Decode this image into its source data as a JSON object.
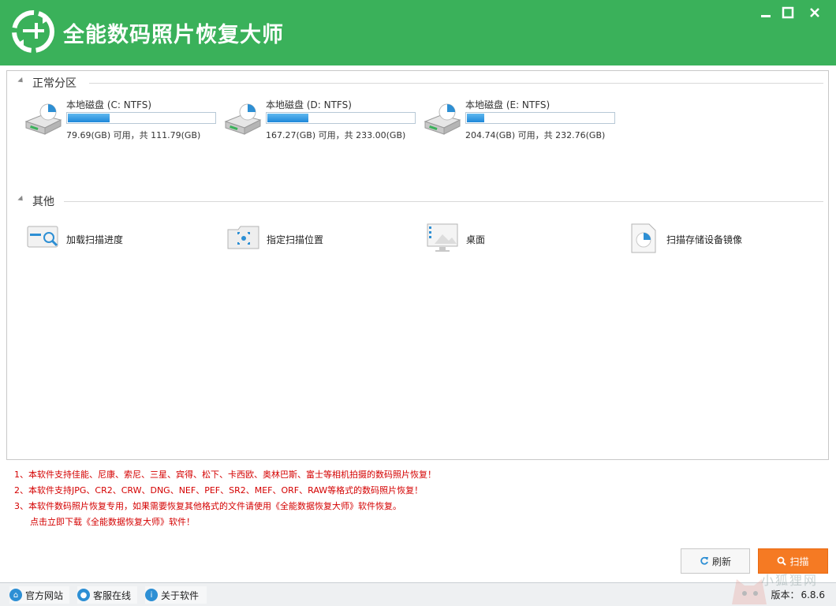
{
  "app": {
    "title": "全能数码照片恢复大师",
    "accent_color": "#3ab15a",
    "window_controls": {
      "minimize_icon": "minimize-icon",
      "maximize_icon": "maximize-icon",
      "close_icon": "close-icon"
    }
  },
  "sections": {
    "partitions_title": "正常分区",
    "other_title": "其他"
  },
  "disks": [
    {
      "name": "本地磁盘 (C: NTFS)",
      "info": "79.69(GB) 可用，共 111.79(GB)",
      "used_fraction": 0.287
    },
    {
      "name": "本地磁盘 (D: NTFS)",
      "info": "167.27(GB) 可用，共 233.00(GB)",
      "used_fraction": 0.282
    },
    {
      "name": "本地磁盘 (E: NTFS)",
      "info": "204.74(GB) 可用，共 232.76(GB)",
      "used_fraction": 0.12
    }
  ],
  "others": [
    {
      "label": "加载扫描进度",
      "icon": "load-progress-icon"
    },
    {
      "label": "指定扫描位置",
      "icon": "scan-location-icon"
    },
    {
      "label": "桌面",
      "icon": "desktop-icon"
    },
    {
      "label": "扫描存储设备镜像",
      "icon": "disk-image-icon"
    }
  ],
  "notes": [
    "1、本软件支持佳能、尼康、索尼、三星、宾得、松下、卡西欧、奥林巴斯、富士等相机拍摄的数码照片恢复！",
    "2、本软件支持JPG、CR2、CRW、DNG、NEF、PEF、SR2、MEF、ORF、RAW等格式的数码照片恢复！",
    "3、本软件数码照片恢复专用，如果需要恢复其他格式的文件请使用《全能数据恢复大师》软件恢复。",
    "点击立即下载《全能数据恢复大师》软件！"
  ],
  "buttons": {
    "refresh": "刷新",
    "scan": "扫描"
  },
  "statusbar": {
    "official_site": "官方网站",
    "customer_service": "客服在线",
    "about": "关于软件",
    "version_label": "版本：",
    "version": "6.8.6"
  },
  "watermark": "小狐狸网"
}
